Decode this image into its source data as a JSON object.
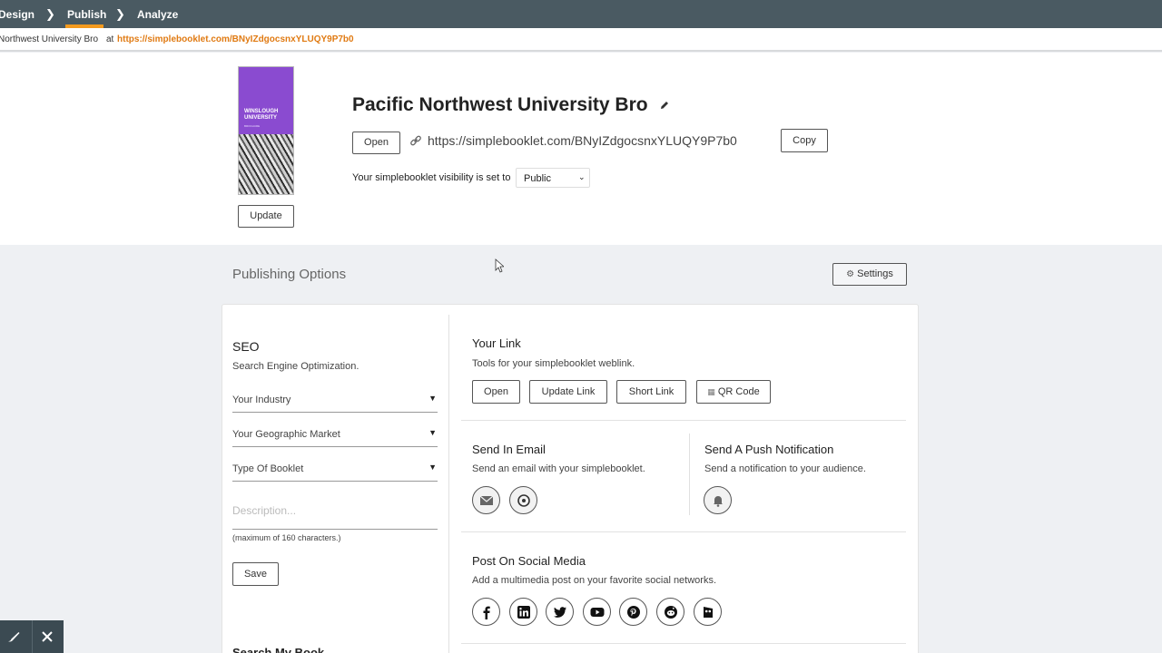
{
  "topnav": {
    "items": [
      {
        "label": "Design"
      },
      {
        "label": "Publish"
      },
      {
        "label": "Analyze"
      }
    ]
  },
  "linkbar": {
    "name": "Northwest University Bro",
    "at": "at",
    "url": "https://simplebooklet.com/BNyIZdgocsnxYLUQY9P7b0"
  },
  "booklet": {
    "cover_title": "WINSLOUGH UNIVERSITY",
    "cover_subtitle": "BROCHURE",
    "update_label": "Update",
    "title": "Pacific Northwest University Bro",
    "open_label": "Open",
    "url": "https://simplebooklet.com/BNyIZdgocsnxYLUQY9P7b0",
    "copy_label": "Copy",
    "visibility_label": "Your simplebooklet visibility is set to",
    "visibility_value": "Public"
  },
  "publishing": {
    "title": "Publishing Options",
    "settings_label": "Settings"
  },
  "seo": {
    "heading": "SEO",
    "subheading": "Search Engine Optimization.",
    "industry": "Your Industry",
    "market": "Your Geographic Market",
    "type": "Type Of Booklet",
    "description_placeholder": "Description...",
    "max_chars": "(maximum of 160 characters.)",
    "save_label": "Save",
    "next_heading": "Search My Book"
  },
  "your_link": {
    "heading": "Your Link",
    "subheading": "Tools for your simplebooklet weblink.",
    "open": "Open",
    "update_link": "Update Link",
    "short_link": "Short Link",
    "qr_code": "QR Code"
  },
  "email": {
    "heading": "Send In Email",
    "subheading": "Send an email with your simplebooklet."
  },
  "push": {
    "heading": "Send A Push Notification",
    "subheading": "Send a notification to your audience."
  },
  "social": {
    "heading": "Post On Social Media",
    "subheading": "Add a multimedia post on your favorite social networks.",
    "networks": [
      "facebook",
      "linkedin",
      "twitter",
      "youtube",
      "pinterest",
      "reddit",
      "hootsuite"
    ]
  },
  "colors": {
    "nav_bg": "#4a5a62",
    "accent": "#f39a1e",
    "url_orange": "#e07a12"
  }
}
